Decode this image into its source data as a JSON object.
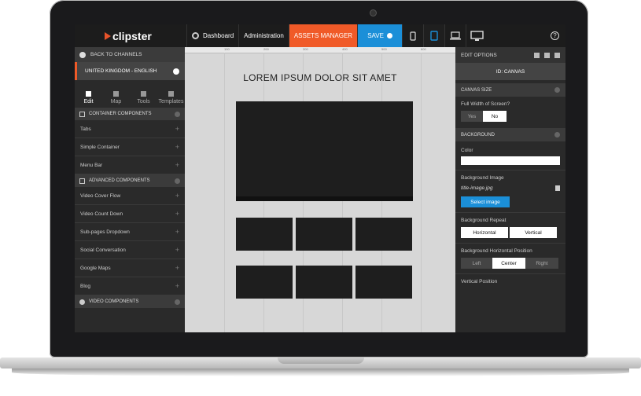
{
  "topbar": {
    "logo": "clipster",
    "dashboard": "Dashboard",
    "administration": "Administration",
    "assets": "ASSETS MANAGER",
    "save": "SAVE",
    "help": "?"
  },
  "left": {
    "back": "BACK TO CHANNELS",
    "locale": "UNITED KINGDOM - ENGLISH",
    "tabs": [
      "Edit",
      "Map",
      "Tools",
      "Templates"
    ],
    "sections": {
      "container": "CONTAINER COMPONENTS",
      "advanced": "ADVANCED COMPONENTS",
      "video": "VIDEO COMPONENTS"
    },
    "container_items": [
      "Tabs",
      "Simple Container",
      "Menu Bar"
    ],
    "advanced_items": [
      "Video Cover Flow",
      "Video Count Down",
      "Sub-pages Dropdown",
      "Social Conversation",
      "Google Maps",
      "Blog"
    ]
  },
  "canvas": {
    "ruler": [
      "100",
      "200",
      "300",
      "400",
      "500",
      "600",
      "700"
    ],
    "title": "LOREM IPSUM DOLOR SIT AMET"
  },
  "right": {
    "header": "EDIT OPTIONS",
    "id": "ID: CANVAS",
    "canvas_size": "CANVAS SIZE",
    "full_width_label": "Full Width of Screen?",
    "yes": "Yes",
    "no": "No",
    "background": "BACKGROUND",
    "color_label": "Color",
    "bg_image_label": "Background Image",
    "bg_image_file": "title-image.jpg",
    "select_image": "Select image",
    "bg_repeat_label": "Background Repeat",
    "horizontal": "Horizontal",
    "vertical": "Vertical",
    "bg_hpos_label": "Background Horizontal Position",
    "left": "Left",
    "center": "Center",
    "right": "Right",
    "vpos_label": "Vertical Position"
  },
  "colors": {
    "accent_orange": "#f05a28",
    "accent_blue": "#1b8fd8",
    "panel": "#2a2a2a"
  }
}
